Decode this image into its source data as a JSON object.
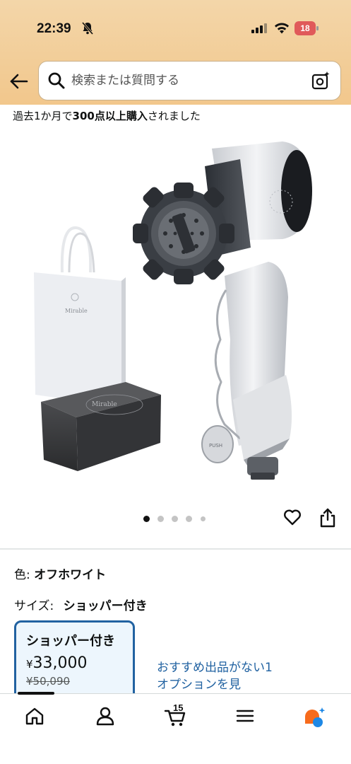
{
  "status_bar": {
    "time": "22:39",
    "battery": "18"
  },
  "search": {
    "placeholder": "検索または質問する"
  },
  "product": {
    "purchase_note_prefix": "過去1か月で",
    "purchase_note_count": "300点以上購入",
    "purchase_note_suffix": "されました",
    "image_count": 5,
    "active_image": 1
  },
  "variations": {
    "color_label": "色:",
    "color_value": "オフホワイト",
    "size_label": "サイズ:",
    "size_value": "ショッパー付き",
    "option": {
      "name": "ショッパー付き",
      "currency": "¥",
      "price": "33,000",
      "list_price": "¥50,090"
    },
    "recommend_text": "おすすめ出品がない1オプションを見"
  },
  "bottom_nav": {
    "cart_count": "15",
    "items": [
      "home",
      "account",
      "cart",
      "menu",
      "rufus"
    ]
  }
}
